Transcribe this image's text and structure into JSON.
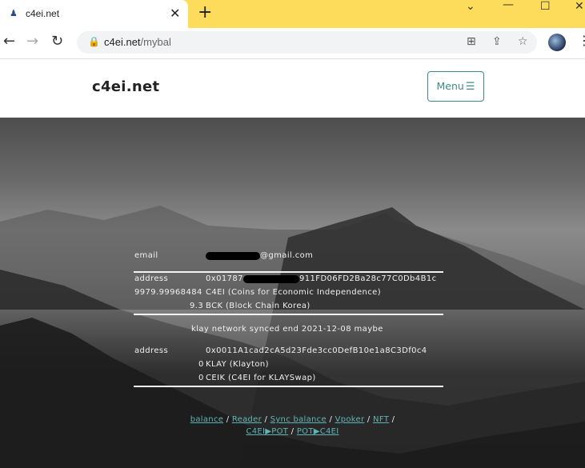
{
  "browser": {
    "tab_title": "c4ei.net",
    "new_tab": "+",
    "url_host": "c4ei.net",
    "url_path": "/mybal"
  },
  "site": {
    "brand": "c4ei.net",
    "menu_label": "Menu"
  },
  "account": {
    "email_label": "email",
    "email_value": "@gmail.com",
    "address_label": "address",
    "address_value_prefix": "0x01787",
    "address_value_suffix": "911FD06FD2Ba28c77C0Db4B1c",
    "balances": [
      {
        "amount": "9979.99968484",
        "unit": "C4EI (Coins for Economic Independence)"
      },
      {
        "amount": "9.3",
        "unit": "BCK (Block Chain Korea)"
      }
    ],
    "sync_note": "klay network synced end 2021-12-08 maybe",
    "klay_address_label": "address",
    "klay_address_value": "0x0011A1cad2cA5d23Fde3cc0DefB10e1a8C3Df0c4",
    "klay_balances": [
      {
        "amount": "0",
        "unit": "KLAY (Klayton)"
      },
      {
        "amount": "0",
        "unit": "CEIK (C4EI for KLAYSwap)"
      }
    ]
  },
  "footer_links": {
    "row1": [
      "balance",
      "Reader",
      "Sync balance",
      "Vpoker",
      "NFT"
    ],
    "row2": [
      "C4EI▶POT",
      "POT▶C4EI"
    ],
    "separator": "/"
  }
}
